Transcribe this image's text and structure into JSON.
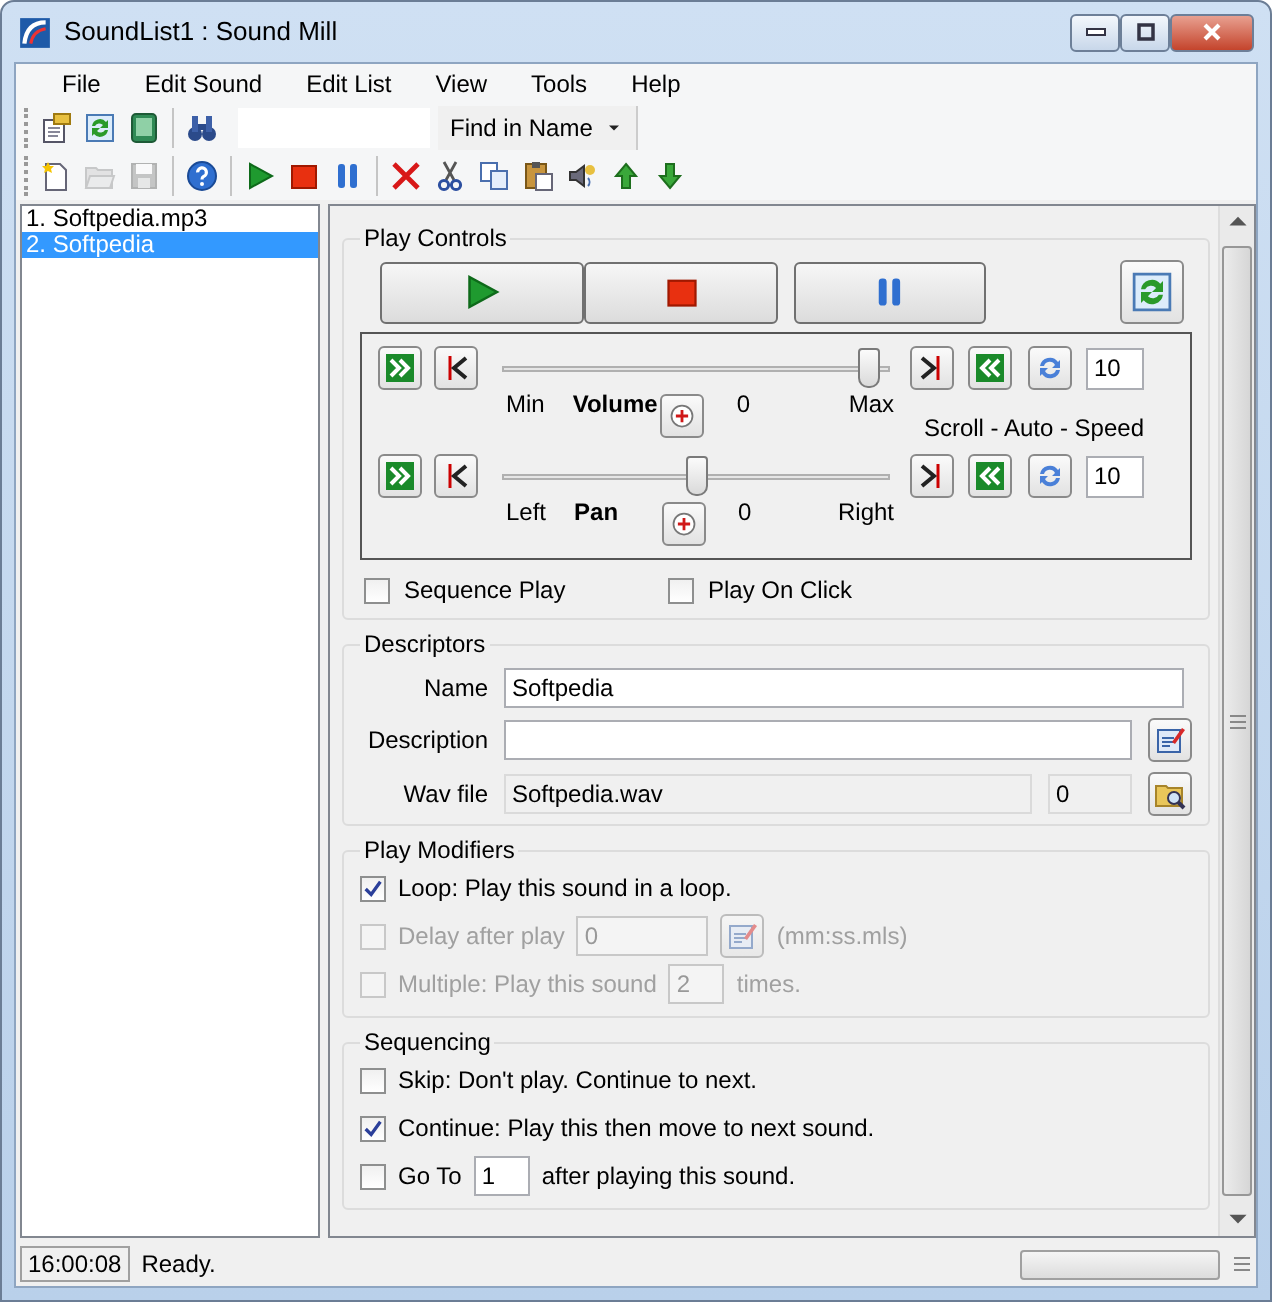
{
  "window": {
    "title": "SoundList1 : Sound Mill"
  },
  "menu": [
    "File",
    "Edit Sound",
    "Edit List",
    "View",
    "Tools",
    "Help"
  ],
  "toolbar_top": {
    "groups": [
      [
        {
          "kind": "properties",
          "disabled": false
        },
        {
          "kind": "refresh",
          "disabled": false
        },
        {
          "kind": "calculator",
          "disabled": false
        }
      ],
      [
        {
          "kind": "binoculars",
          "disabled": false
        }
      ]
    ],
    "search_mode": "Find in Name"
  },
  "toolbar_bottom": {
    "groups": [
      [
        {
          "kind": "new",
          "disabled": false
        },
        {
          "kind": "open",
          "disabled": true
        },
        {
          "kind": "save",
          "disabled": true
        }
      ],
      [
        {
          "kind": "help",
          "disabled": false
        }
      ],
      [
        {
          "kind": "play",
          "disabled": false
        },
        {
          "kind": "stop",
          "disabled": false
        },
        {
          "kind": "pause",
          "disabled": false
        }
      ],
      [
        {
          "kind": "delete",
          "disabled": false
        },
        {
          "kind": "cut",
          "disabled": false
        },
        {
          "kind": "copy",
          "disabled": false
        },
        {
          "kind": "paste",
          "disabled": false
        },
        {
          "kind": "speaker",
          "disabled": false
        },
        {
          "kind": "up",
          "disabled": false
        },
        {
          "kind": "down",
          "disabled": false
        }
      ]
    ]
  },
  "sound_list": {
    "items": [
      {
        "label": "1. Softpedia.mp3",
        "selected": false
      },
      {
        "label": "2. Softpedia",
        "selected": true
      }
    ]
  },
  "play_controls": {
    "title": "Play Controls",
    "sliders": [
      {
        "name": "Volume",
        "min_label": "Min",
        "max_label": "Max",
        "reading": "0",
        "level": 0.97,
        "speed": "10"
      },
      {
        "name": "Pan",
        "min_label": "Left",
        "max_label": "Right",
        "reading": "0",
        "level": 0.5,
        "speed": "10"
      }
    ],
    "speed_caption": "Scroll - Auto - Speed",
    "options": [
      {
        "label": "Sequence Play",
        "checked": false
      },
      {
        "label": "Play On Click",
        "checked": false
      }
    ]
  },
  "descriptors": {
    "title": "Descriptors",
    "name": {
      "label": "Name",
      "value": "Softpedia"
    },
    "description": {
      "label": "Description"
    },
    "wav_file": {
      "label": "Wav file",
      "value": "Softpedia.wav",
      "size": "0"
    }
  },
  "play_modifiers": {
    "title": "Play Modifiers",
    "items": [
      {
        "kind": "check",
        "label": "Loop: Play this sound in a loop.",
        "checked": true,
        "disabled": false
      },
      {
        "kind": "delay",
        "label": "Delay after play",
        "value": "0",
        "suffix": "(mm:ss.mls)",
        "checked": false,
        "disabled": true
      },
      {
        "kind": "count",
        "label": "Multiple: Play this sound",
        "value": "2",
        "suffix": "times.",
        "checked": false,
        "disabled": true
      }
    ]
  },
  "sequencing": {
    "title": "Sequencing",
    "items": [
      {
        "kind": "check",
        "label": "Skip: Don't play. Continue to next.",
        "checked": false,
        "disabled": false
      },
      {
        "kind": "check",
        "label": "Continue: Play this then move to next sound.",
        "checked": true,
        "disabled": false
      },
      {
        "kind": "count",
        "label": "Go To",
        "value": "1",
        "suffix": "after playing this sound.",
        "checked": false,
        "disabled": false
      }
    ]
  },
  "status_bar": {
    "time": "16:00:08",
    "message": "Ready.",
    "level": 0
  }
}
